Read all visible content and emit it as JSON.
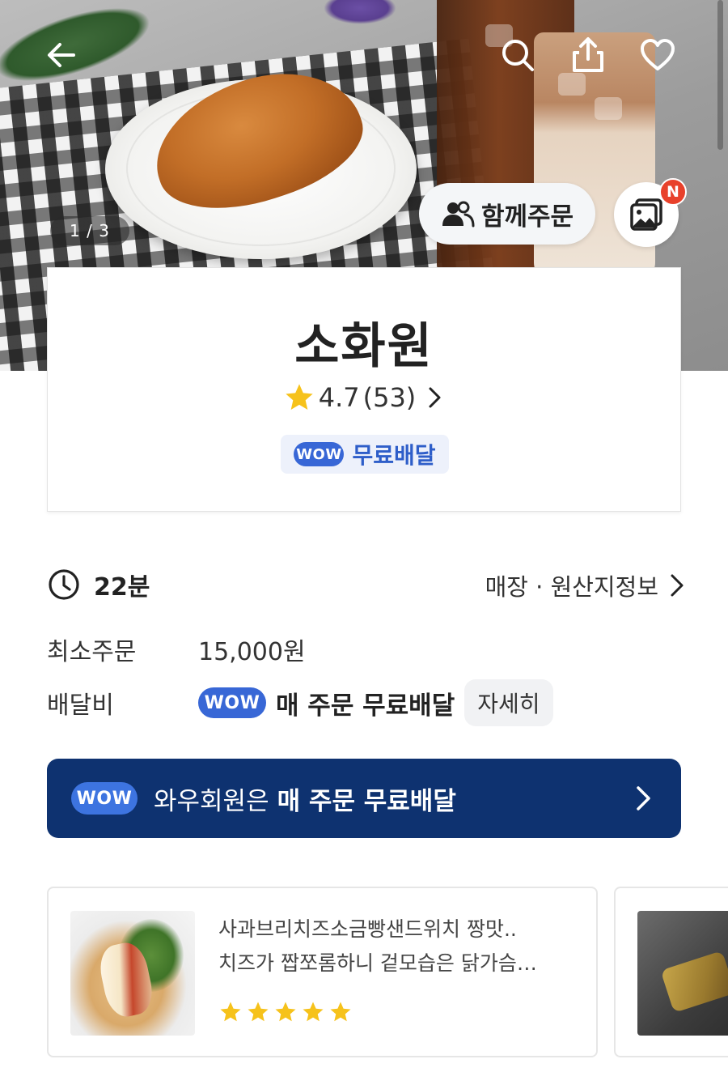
{
  "hero": {
    "image_counter": "1 / 3",
    "group_order_label": "함께주문",
    "new_badge": "N",
    "icons": [
      "back-arrow-icon",
      "search-icon",
      "share-icon",
      "heart-icon",
      "people-icon",
      "photo-review-icon"
    ]
  },
  "store": {
    "name": "소화원",
    "rating": "4.7",
    "review_count": "(53)",
    "wow_badge": "WOW",
    "free_delivery_label": "무료배달"
  },
  "info": {
    "delivery_time": "22분",
    "origin_link": "매장 · 원산지정보",
    "min_order_label": "최소주문",
    "min_order_value": "15,000원",
    "delivery_fee_label": "배달비",
    "delivery_fee_wow": "WOW",
    "delivery_fee_value": "매 주문 무료배달",
    "detail_button": "자세히"
  },
  "wow_banner": {
    "badge": "WOW",
    "text_regular": "와우회원은",
    "text_bold": "매 주문 무료배달"
  },
  "reviews": [
    {
      "line1": "사과브리치즈소금빵샌드위치 짱맛..",
      "line2": "치즈가 짭쪼롬하니 겉모습은 닭가슴…",
      "stars": 5
    }
  ],
  "colors": {
    "wow_blue": "#3867d6",
    "banner_navy": "#0e3270",
    "star_yellow": "#f6c21b",
    "badge_red": "#e8412b"
  }
}
